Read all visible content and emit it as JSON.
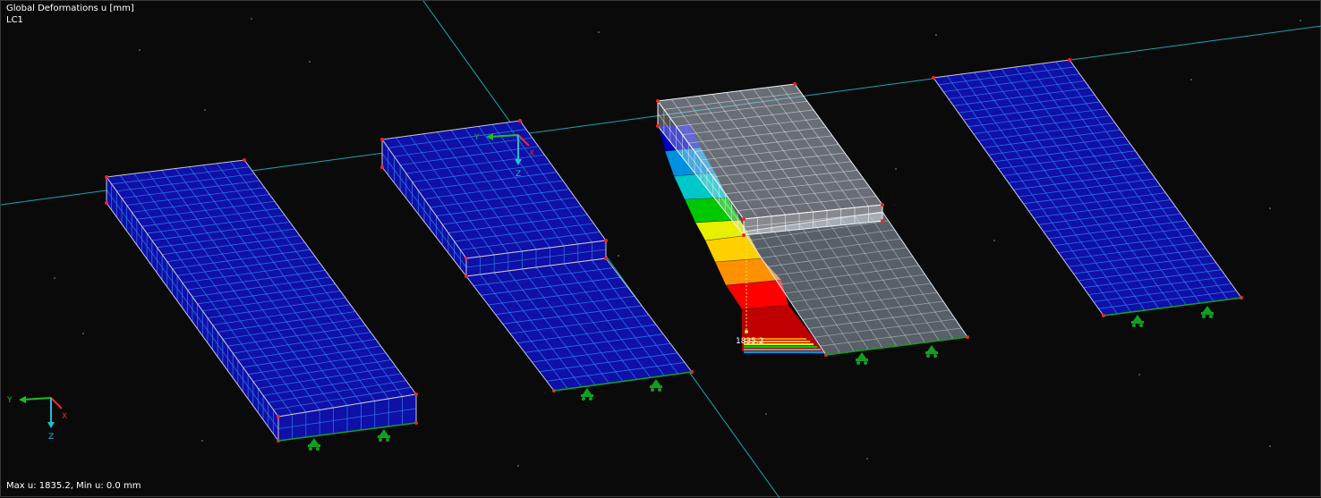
{
  "viewport": {
    "result_title": "Global Deformations u [mm]",
    "load_case": "LC1",
    "status_line": "Max u: 1835.2, Min u: 0.0 mm",
    "max_label": "1835.2"
  },
  "axes": {
    "corner": {
      "y": "Y",
      "x": "X",
      "z": "Z"
    },
    "model": {
      "y": "Y",
      "x": "X",
      "z": "Z"
    }
  },
  "colors": {
    "background": "#0a0a0a",
    "mesh_fill": "#0f10a8",
    "mesh_line": "#2f78e8",
    "edge": "#c8c8dc",
    "node": "#ff2020",
    "guide_line": "#1aa6b0",
    "support": "#10a020",
    "axis_y": "#20c020",
    "axis_x": "#e03030",
    "axis_z": "#20c0d0",
    "contour": [
      "#c00000",
      "#ff0000",
      "#ff9000",
      "#ffd000",
      "#e8f000",
      "#00c800",
      "#00c8c8",
      "#0090e0",
      "#0000c0"
    ]
  }
}
